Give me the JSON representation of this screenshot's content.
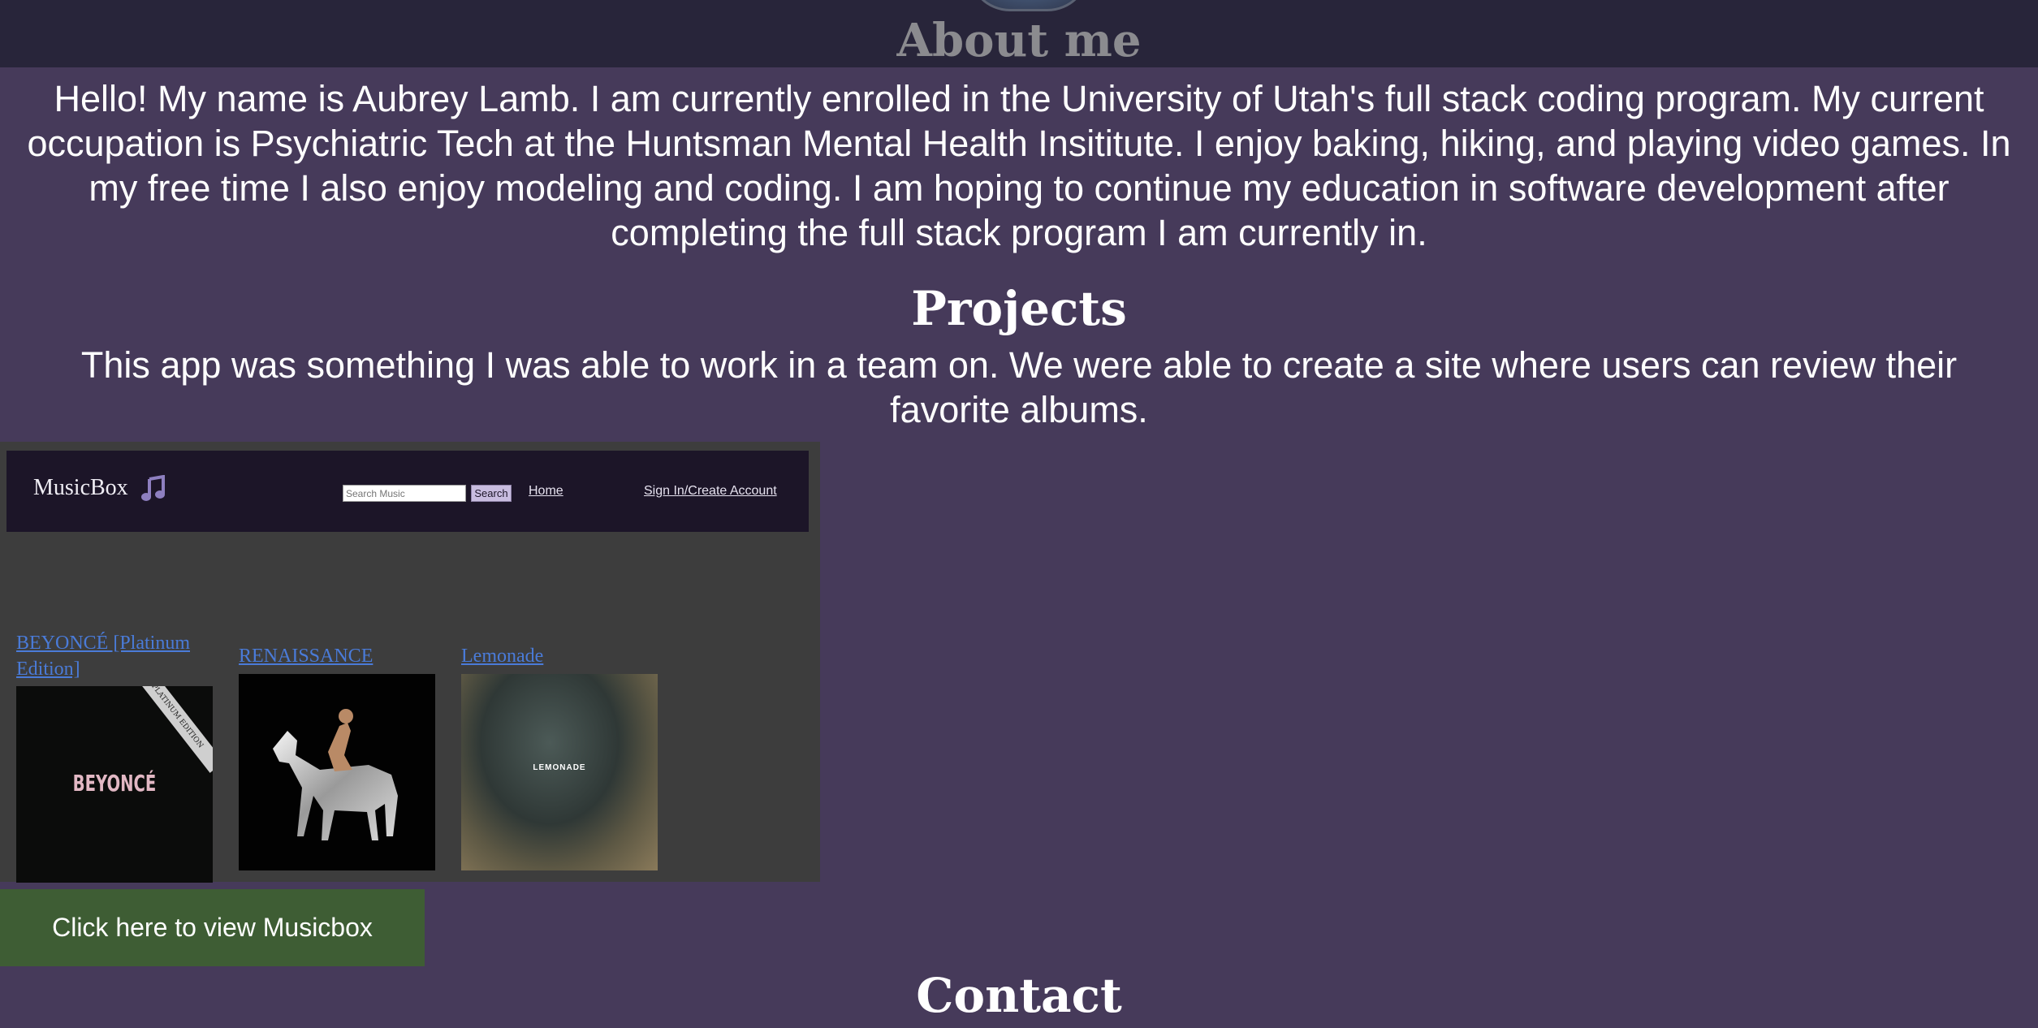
{
  "header": {
    "title": "About me"
  },
  "about": {
    "text": "Hello! My name is Aubrey Lamb. I am currently enrolled in the University of Utah's full stack coding program. My current occupation is Psychiatric Tech at the Huntsman Mental Health Insititute. I enjoy baking, hiking, and playing video games. In my free time I also enjoy modeling and coding. I am hoping to continue my education in software development after completing the full stack program I am currently in."
  },
  "projects": {
    "title": "Projects",
    "description": "This app was something I was able to work in a team on. We were able to create a site where users can review their favorite albums.",
    "screenshot": {
      "brand": "MusicBox",
      "brand_icon": "music-note-icon",
      "search_placeholder": "Search Music",
      "search_button": "Search",
      "nav_home": "Home",
      "nav_signin": "Sign In/Create Account",
      "albums": [
        {
          "title": "BEYONCÉ [Platinum Edition]",
          "cover_text": "BEYONCÉ",
          "ribbon_text": "PLATINUM EDITION"
        },
        {
          "title": "RENAISSANCE"
        },
        {
          "title": "Lemonade",
          "cover_text": "LEMONADE"
        }
      ]
    },
    "view_button": "Click here to view Musicbox"
  },
  "contact": {
    "title": "Contact"
  },
  "colors": {
    "background": "#463a5a",
    "header": "#28253a",
    "button": "#3e5d34",
    "link": "#4a7bd8"
  }
}
